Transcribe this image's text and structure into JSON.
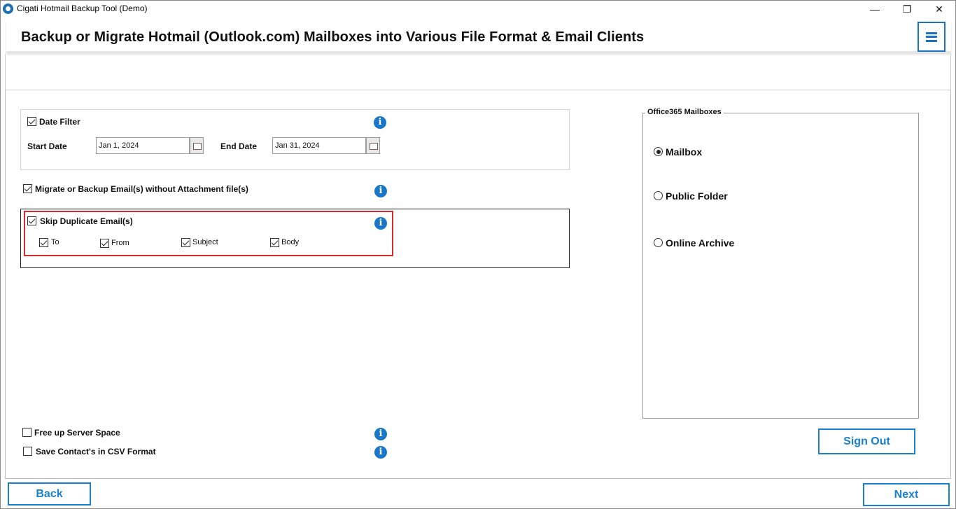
{
  "window": {
    "title": "Cigati Hotmail Backup Tool (Demo)",
    "minimize_glyph": "—",
    "maximize_glyph": "❐",
    "close_glyph": "✕"
  },
  "header": {
    "title": "Backup or Migrate Hotmail (Outlook.com) Mailboxes into Various File Format & Email Clients",
    "menu_icon": "hamburger-menu-icon"
  },
  "filters": {
    "date_filter": {
      "label": "Date Filter",
      "checked": true
    },
    "start_date_label": "Start Date",
    "start_date_value": "Jan 1, 2024",
    "end_date_label": "End Date",
    "end_date_value": "Jan 31, 2024",
    "without_attachments": {
      "label": "Migrate or Backup Email(s) without Attachment file(s)",
      "checked": true
    },
    "skip_duplicate": {
      "label": "Skip Duplicate Email(s)",
      "checked": true,
      "options": [
        {
          "label": "To",
          "checked": true
        },
        {
          "label": "From",
          "checked": true
        },
        {
          "label": "Subject",
          "checked": true
        },
        {
          "label": "Body",
          "checked": true
        }
      ]
    },
    "free_server_space": {
      "label": "Free up Server Space",
      "checked": false
    },
    "save_contacts_csv": {
      "label": "Save Contact's in CSV Format",
      "checked": false
    },
    "info_glyph": "i"
  },
  "office365": {
    "legend": "Office365 Mailboxes",
    "options": [
      {
        "label": "Mailbox",
        "selected": true
      },
      {
        "label": "Public Folder",
        "selected": false
      },
      {
        "label": "Online Archive",
        "selected": false
      }
    ]
  },
  "buttons": {
    "sign_out": "Sign Out",
    "back": "Back",
    "next": "Next"
  },
  "colors": {
    "accent": "#1a80cf",
    "highlight_border": "#d42b2b",
    "info_icon": "#1976c9"
  }
}
